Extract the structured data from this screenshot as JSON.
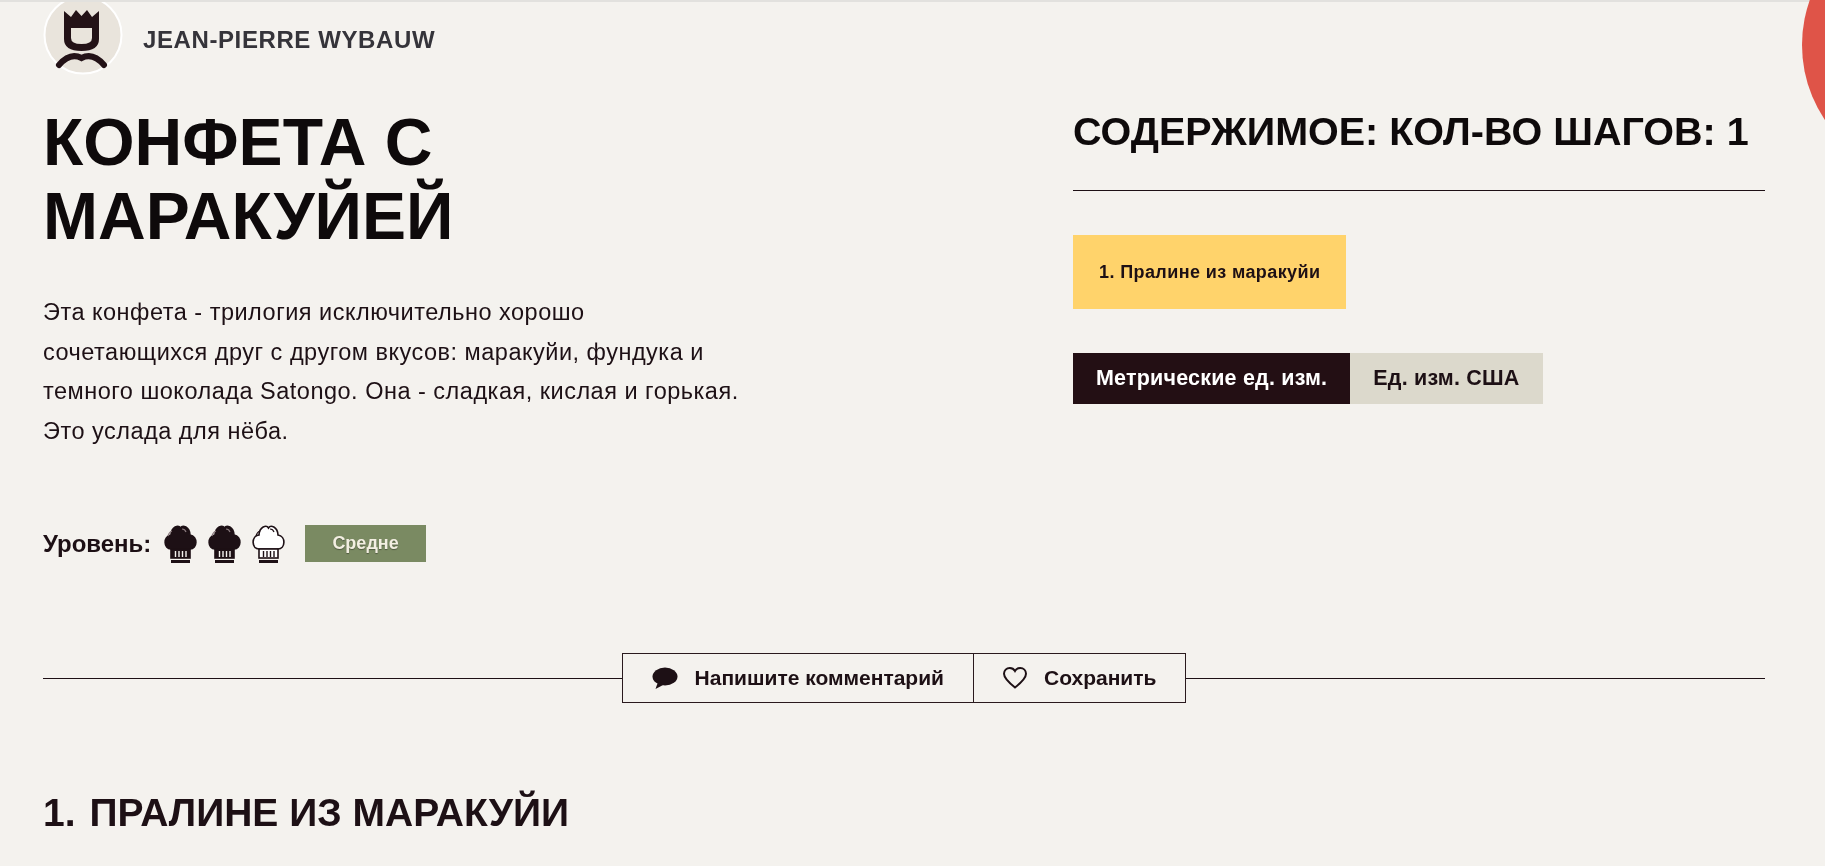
{
  "author": {
    "name": "JEAN-PIERRE WYBAUW"
  },
  "recipe": {
    "title": "КОНФЕТА С МАРАКУЙЕЙ",
    "description": "Эта конфета - трилогия исключительно хорошо сочетающихся друг с другом вкусов: маракуйи, фундука и темного шоколада Satongo. Она - сладкая, кислая и горькая. Это услада для нёба.",
    "level": {
      "label": "Уровень:",
      "stars": 2,
      "badge": "Средне"
    }
  },
  "contents": {
    "title": "СОДЕРЖИМОЕ: КОЛ-ВО ШАГОВ: 1",
    "steps": [
      {
        "label": "1. Пралине из маракуйи"
      }
    ],
    "units": [
      {
        "label": "Метрические ед. изм.",
        "selected": true
      },
      {
        "label": "Ед. изм. США",
        "selected": false
      }
    ]
  },
  "actions": [
    {
      "kind": "comment",
      "label": "Напишите комментарий"
    },
    {
      "kind": "save",
      "label": "Сохранить"
    }
  ],
  "section": {
    "number": "1.",
    "title": "ПРАЛИНЕ ИЗ МАРАКУЙИ"
  }
}
